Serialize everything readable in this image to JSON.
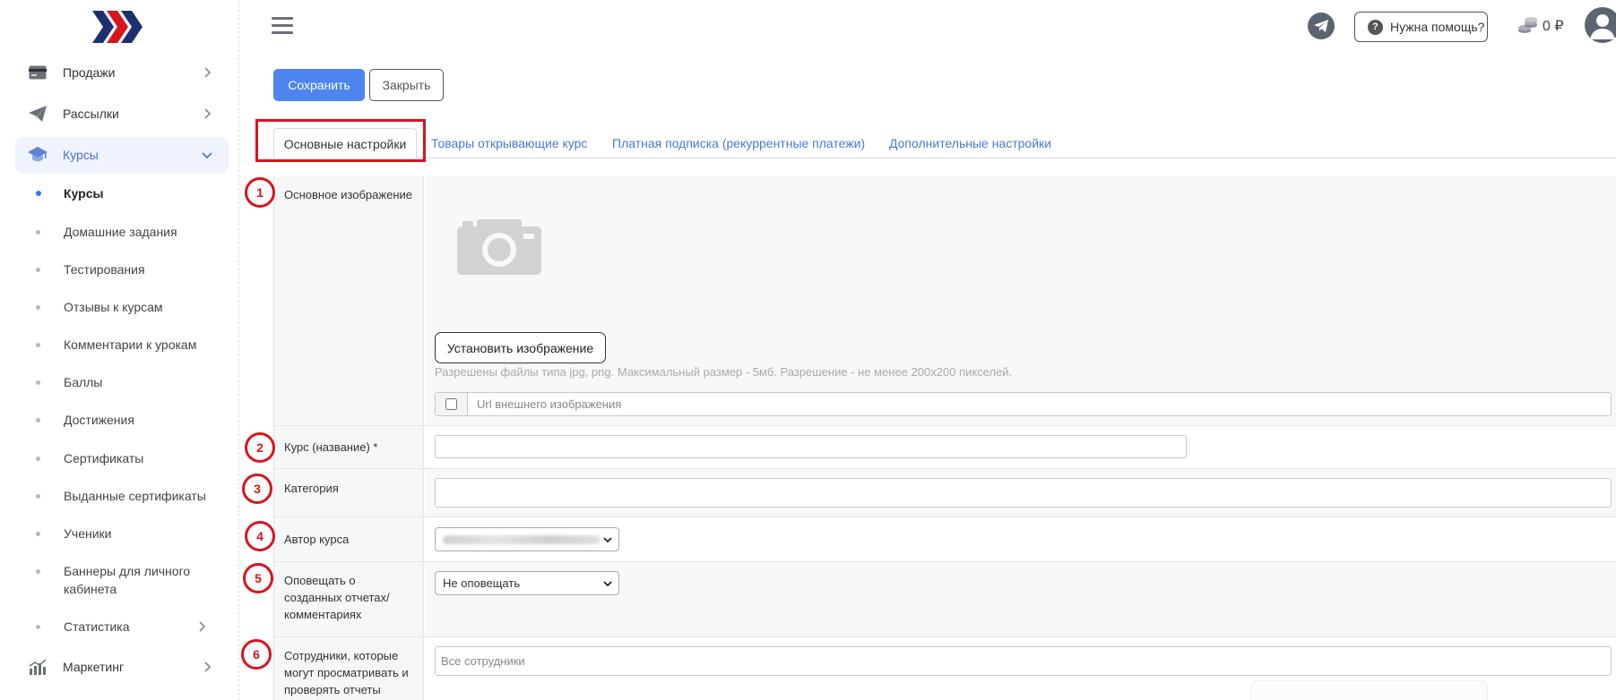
{
  "sidebar": {
    "items": [
      {
        "label": "Продажи",
        "icon": "credit-card-icon"
      },
      {
        "label": "Рассылки",
        "icon": "paper-plane-icon"
      },
      {
        "label": "Курсы",
        "icon": "graduation-cap-icon",
        "active": true
      },
      {
        "label": "Маркетинг",
        "icon": "chart-bars-icon"
      }
    ],
    "sub": [
      {
        "label": "Курсы",
        "active": true
      },
      {
        "label": "Домашние задания"
      },
      {
        "label": "Тестирования"
      },
      {
        "label": "Отзывы к курсам"
      },
      {
        "label": "Комментарии к урокам"
      },
      {
        "label": "Баллы"
      },
      {
        "label": "Достижения"
      },
      {
        "label": "Сертификаты"
      },
      {
        "label": "Выданные сертификаты"
      },
      {
        "label": "Ученики"
      },
      {
        "label": "Баннеры для личного кабинета"
      },
      {
        "label": "Статистика"
      }
    ]
  },
  "header": {
    "help_label": "Нужна помощь?",
    "balance": "0 ₽"
  },
  "toolbar": {
    "save_label": "Сохранить",
    "close_label": "Закрыть"
  },
  "tabs": [
    {
      "label": "Основные настройки",
      "active": true
    },
    {
      "label": "Товары открывающие курс"
    },
    {
      "label": "Платная подписка (рекуррентные платежи)"
    },
    {
      "label": "Дополнительные настройки"
    }
  ],
  "form": {
    "image": {
      "badge": "1",
      "label": "Основное изображение",
      "button": "Установить изображение",
      "hint": "Разрешены файлы типа jpg, png. Максимальный размер - 5мб. Разрешение - не менее 200x200 пикселей.",
      "url_placeholder": "Url внешнего изображения"
    },
    "name": {
      "badge": "2",
      "label": "Курс (название) *",
      "value": ""
    },
    "category": {
      "badge": "3",
      "label": "Категория",
      "value": ""
    },
    "author": {
      "badge": "4",
      "label": "Автор курса"
    },
    "notify": {
      "badge": "5",
      "label": "Оповещать о созданных отчетах/ комментариях",
      "selected": "Не оповещать"
    },
    "staff": {
      "badge": "6",
      "label": "Сотрудники, которые могут просматривать и проверять отчеты",
      "placeholder": "Все сотрудники"
    }
  },
  "colors": {
    "accent": "#4d84f0",
    "highlight": "#d9141c",
    "link": "#4a78d6"
  }
}
